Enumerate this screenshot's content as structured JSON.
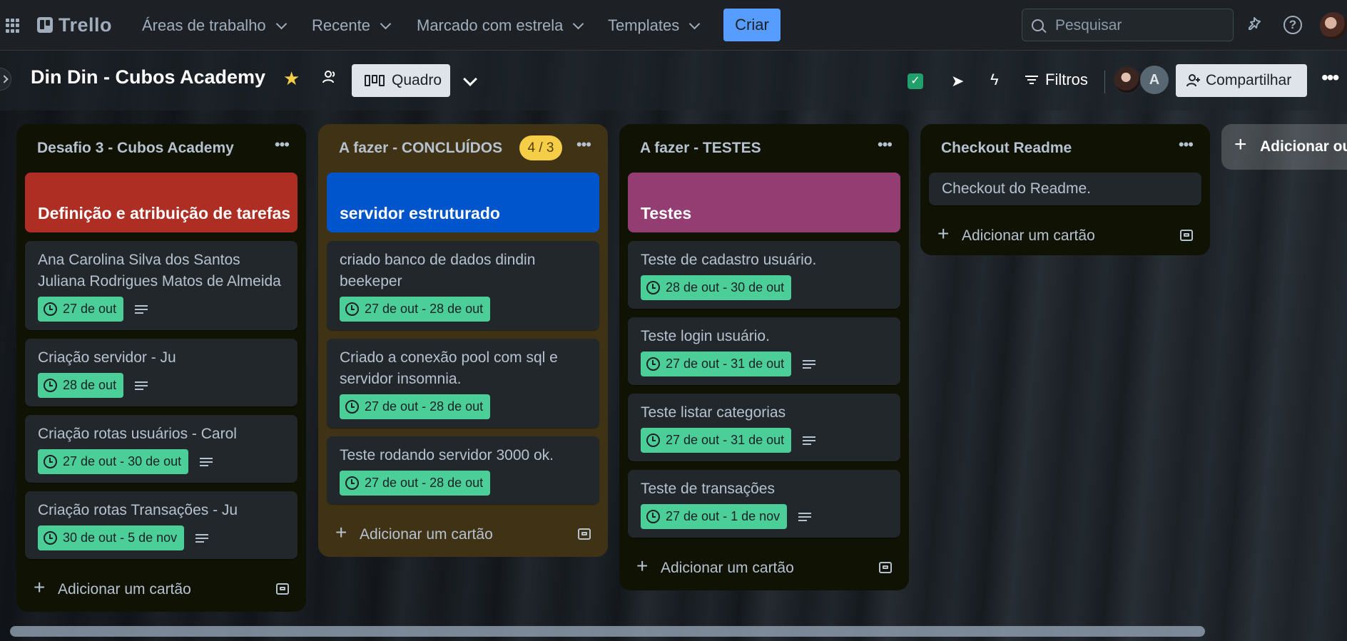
{
  "nav": {
    "logo": "Trello",
    "menus": [
      "Áreas de trabalho",
      "Recente",
      "Marcado com estrela",
      "Templates"
    ],
    "create_label": "Criar",
    "search_placeholder": "Pesquisar"
  },
  "board": {
    "title": "Din Din - Cubos Academy",
    "view_label": "Quadro",
    "filters_label": "Filtros",
    "member_initial": "A",
    "share_label": "Compartilhar",
    "add_list_label": "Adicionar outra lista"
  },
  "add_card_label": "Adicionar um cartão",
  "lists": [
    {
      "title": "Desafio 3 - Cubos Academy",
      "cover": {
        "text": "Definição e atribuição de tarefas",
        "color": "#ae2e24"
      },
      "cards": [
        {
          "text": "Ana Carolina Silva dos Santos Juliana Rodrigues Matos de Almeida",
          "date": "27 de out",
          "desc": true
        },
        {
          "text": "Criação servidor - Ju",
          "date": "28 de out",
          "desc": true
        },
        {
          "text": "Criação rotas usuários - Carol",
          "date": "27 de out - 30 de out",
          "desc": true
        },
        {
          "text": "Criação rotas Transações - Ju",
          "date": "30 de out - 5 de nov",
          "desc": true
        }
      ]
    },
    {
      "title": "A fazer - CONCLUÍDOS",
      "badge": "4 / 3",
      "cover": {
        "text": "servidor estruturado",
        "color": "#0055cc"
      },
      "cards": [
        {
          "text": "criado banco de dados dindin beekeper",
          "date": "27 de out - 28 de out",
          "desc": false
        },
        {
          "text": "Criado a conexão pool com sql e servidor insomnia.",
          "date": "27 de out - 28 de out",
          "desc": false
        },
        {
          "text": "Teste rodando servidor 3000 ok.",
          "date": "27 de out - 28 de out",
          "desc": false
        }
      ]
    },
    {
      "title": "A fazer - TESTES",
      "cover": {
        "text": "Testes",
        "color": "#943d73"
      },
      "cards": [
        {
          "text": "Teste de cadastro usuário.",
          "date": "28 de out - 30 de out",
          "desc": false
        },
        {
          "text": "Teste login usuário.",
          "date": "27 de out - 31 de out",
          "desc": true
        },
        {
          "text": "Teste listar categorias",
          "date": "27 de out - 31 de out",
          "desc": true
        },
        {
          "text": "Teste de transações",
          "date": "27 de out - 1 de nov",
          "desc": true
        }
      ]
    },
    {
      "title": "Checkout Readme",
      "cards": [
        {
          "text": "Checkout do Readme."
        }
      ]
    }
  ],
  "colors": {
    "date_badge": "#4bce97",
    "create_button": "#579dff",
    "count_badge": "#f5cd47"
  }
}
